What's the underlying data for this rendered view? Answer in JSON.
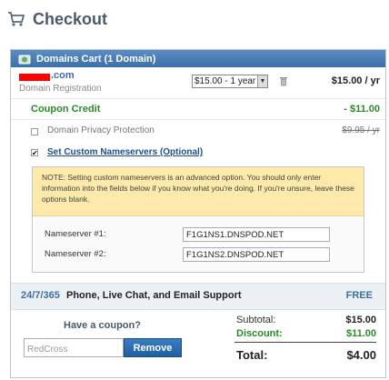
{
  "header": {
    "title": "Checkout",
    "icon": "shopping-cart-icon"
  },
  "cart": {
    "heading": "Domains Cart (1 Domain)",
    "heading_icon": "domain-globe-icon",
    "domain": {
      "tld": ".com",
      "type": "Domain Registration",
      "term_selected": "$15.00 - 1 year",
      "price": "$15.00 / yr"
    },
    "coupon_credit": {
      "label": "Coupon Credit",
      "value": "- $11.00"
    },
    "privacy": {
      "label": "Domain Privacy Protection",
      "price": "$9.95 / yr",
      "checked": false
    },
    "nameservers": {
      "label": "Set Custom Nameservers (Optional)",
      "checked": true,
      "note": "NOTE: Setting custom nameservers is an advanced option. You should only enter information into the fields below if you know what you're doing. If you're unsure, leave these options blank.",
      "ns1_label": "Nameserver #1:",
      "ns1_value": "F1G1NS1.DNSPOD.NET",
      "ns2_label": "Nameserver #2:",
      "ns2_value": "F1G1NS2.DNSPOD.NET"
    },
    "support": {
      "hours": "24/7/365",
      "text": "Phone, Live Chat, and Email Support",
      "price": "FREE"
    }
  },
  "coupon": {
    "heading": "Have a coupon?",
    "value": "RedCross",
    "remove_label": "Remove"
  },
  "totals": {
    "subtotal_label": "Subtotal:",
    "subtotal_value": "$15.00",
    "discount_label": "Discount:",
    "discount_value": "$11.00",
    "total_label": "Total:",
    "total_value": "$4.00"
  }
}
